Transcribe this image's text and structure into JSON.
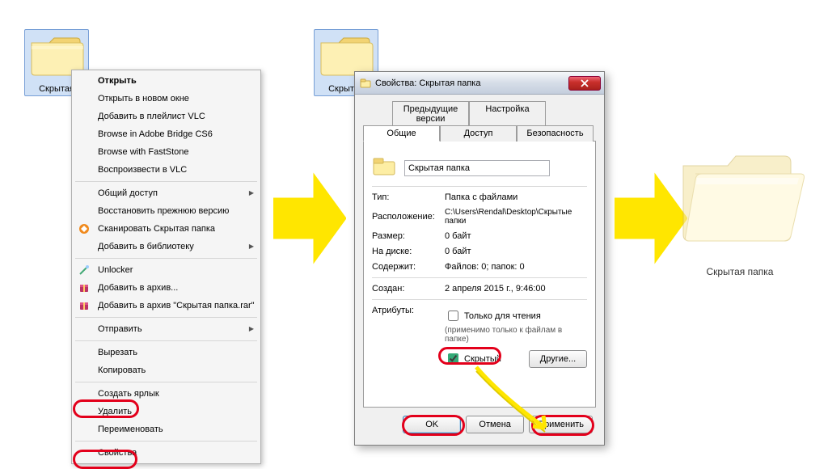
{
  "folders": {
    "left_label": "Скрытая",
    "mid_label": "Скрытая",
    "hidden_label": "Скрытая папка"
  },
  "context_menu": {
    "open": "Открыть",
    "open_new_window": "Открыть в новом окне",
    "add_vlc_playlist": "Добавить в плейлист VLC",
    "browse_bridge": "Browse in Adobe Bridge CS6",
    "browse_faststone": "Browse with FastStone",
    "play_vlc": "Воспроизвести в VLC",
    "sharing": "Общий доступ",
    "restore_prev": "Восстановить прежнюю версию",
    "scan": "Сканировать Скрытая папка",
    "add_library": "Добавить в библиотеку",
    "unlocker": "Unlocker",
    "add_archive": "Добавить в архив...",
    "add_archive_rar": "Добавить в архив \"Скрытая папка.rar\"",
    "send_to": "Отправить",
    "cut": "Вырезать",
    "copy": "Копировать",
    "shortcut": "Создать ярлык",
    "delete": "Удалить",
    "rename": "Переименовать",
    "properties": "Свойства"
  },
  "dialog": {
    "title": "Свойства: Скрытая папка",
    "tabs": {
      "prev_versions": "Предыдущие версии",
      "customize": "Настройка",
      "general": "Общие",
      "sharing": "Доступ",
      "security": "Безопасность"
    },
    "name_value": "Скрытая папка",
    "rows": {
      "type_l": "Тип:",
      "type_v": "Папка с файлами",
      "loc_l": "Расположение:",
      "loc_v": "C:\\Users\\Rendal\\Desktop\\Скрытые папки",
      "size_l": "Размер:",
      "size_v": "0 байт",
      "ondisk_l": "На диске:",
      "ondisk_v": "0 байт",
      "contains_l": "Содержит:",
      "contains_v": "Файлов: 0; папок: 0",
      "created_l": "Создан:",
      "created_v": "2 апреля 2015 г., 9:46:00",
      "attrs_l": "Атрибуты:"
    },
    "readonly_l": "Только для чтения",
    "readonly_note": "(применимо только к файлам в папке)",
    "hidden_l": "Скрытый",
    "other_btn": "Другие...",
    "ok": "OK",
    "cancel": "Отмена",
    "apply": "Применить"
  }
}
